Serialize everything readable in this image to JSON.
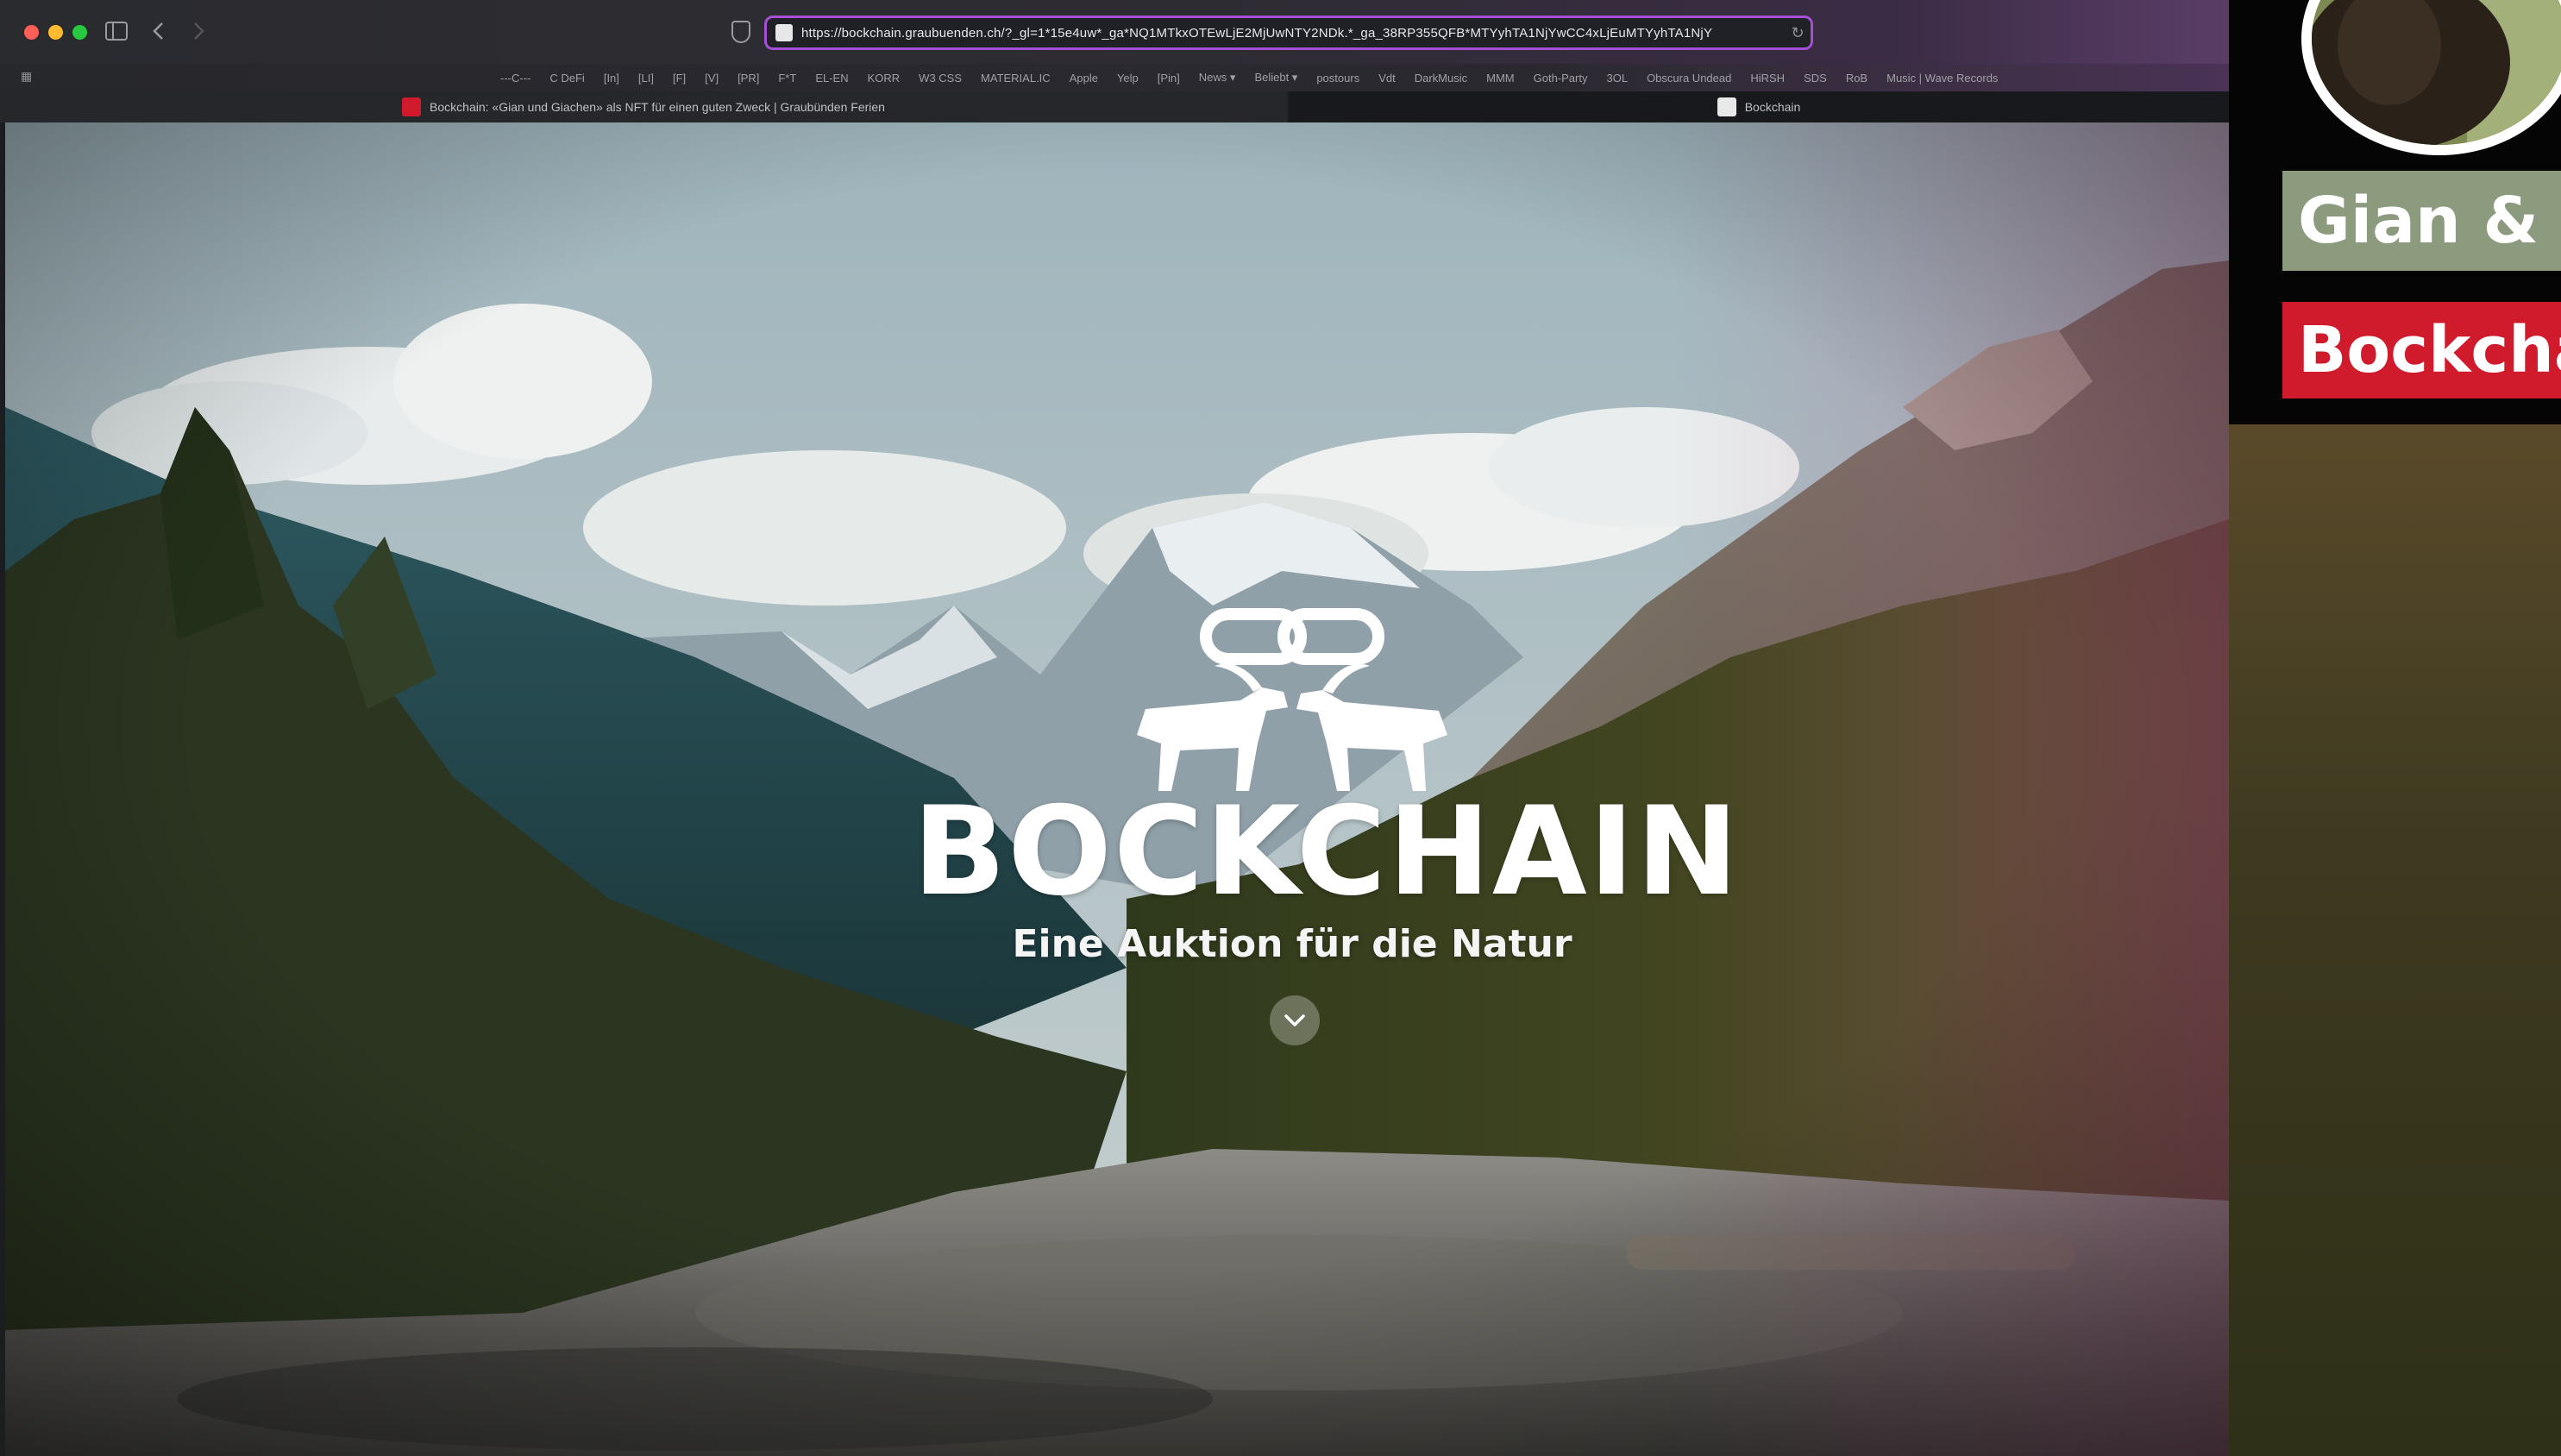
{
  "browser": {
    "url": "https://bockchain.graubuenden.ch/?_gl=1*15e4uw*_ga*NQ1MTkxOTEwLjE2MjUwNTY2NDk.*_ga_38RP355QFB*MTYyhTA1NjYwCC4xLjEuMTYyhTA1NjY",
    "bookmarks": [
      "---C---",
      "C DeFi",
      "[In]",
      "[LI]",
      "[F]",
      "[V]",
      "[PR]",
      "F*T",
      "EL-EN",
      "KORR",
      "W3 CSS",
      "MATERIAL.IC",
      "Apple",
      "Yelp",
      "[Pin]",
      "News ▾",
      "Beliebt ▾",
      "postours",
      "Vdt",
      "DarkMusic",
      "MMM",
      "Goth-Party",
      "3OL",
      "Obscura Undead",
      "HiRSH",
      "SDS",
      "RoB",
      "Music | Wave Records"
    ],
    "tabs": [
      {
        "title": "Bockchain: «Gian und Giachen» als NFT für einen guten Zweck | Graubünden Ferien",
        "active": true
      },
      {
        "title": "Bockchain",
        "active": false
      }
    ]
  },
  "hero": {
    "brand": "BOCKCHAIN",
    "tagline": "Eine Auktion für die Natur",
    "scroll_icon": "chevron-down-icon"
  },
  "overlay": {
    "title": "Gian & G",
    "subtitle": "Bockcha"
  },
  "colors": {
    "url_border": "#a54ed6",
    "overlay_title_bg": "#8c9a7d",
    "overlay_sub_bg": "#cf1b2b"
  }
}
